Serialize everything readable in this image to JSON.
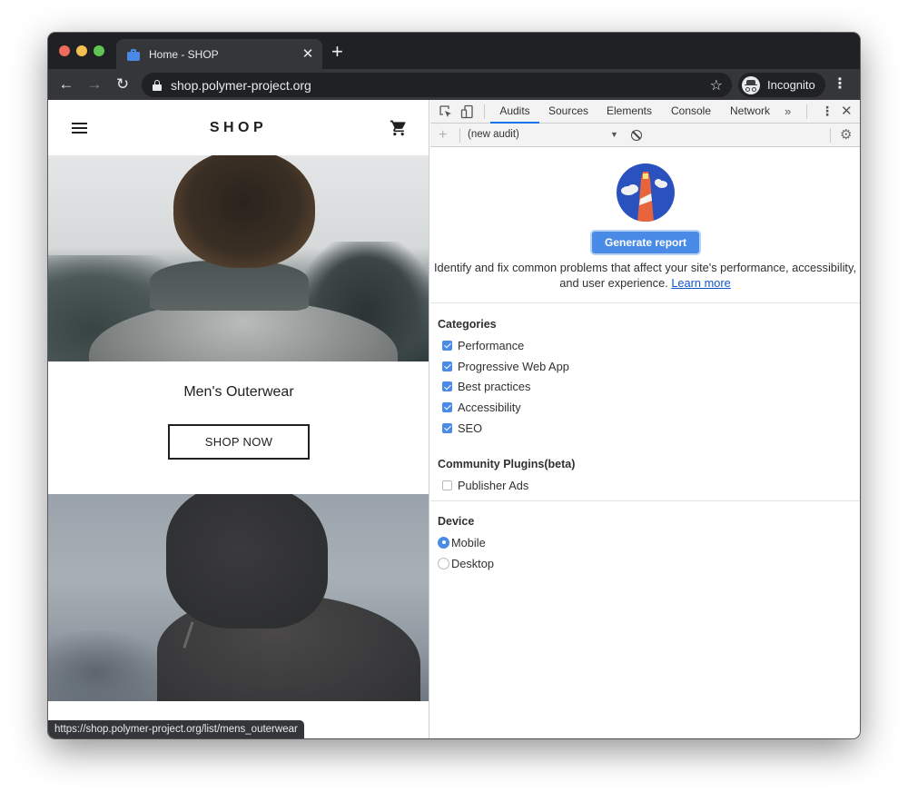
{
  "browser": {
    "tab": {
      "title": "Home - SHOP",
      "favicon": "shopping-bag-icon",
      "close_glyph": "✕"
    },
    "new_tab_glyph": "+",
    "nav": {
      "back_glyph": "←",
      "forward_glyph": "→",
      "reload_glyph": "↻"
    },
    "address_bar": {
      "url": "shop.polymer-project.org",
      "secure_icon": "lock-icon",
      "bookmark_glyph": "☆"
    },
    "profile": {
      "label": "Incognito",
      "icon": "incognito-icon"
    },
    "menu_glyph": "⋮",
    "status_url": "https://shop.polymer-project.org/list/mens_outerwear"
  },
  "page": {
    "header": {
      "title": "SHOP",
      "menu_icon": "hamburger-icon",
      "cart_icon": "cart-icon"
    },
    "promo": {
      "title": "Men's Outerwear",
      "button_label": "SHOP NOW"
    },
    "images": [
      {
        "alt": "man-in-grey-sweater-hero"
      },
      {
        "alt": "person-in-hooded-sweater-hero"
      }
    ]
  },
  "devtools": {
    "tabs": [
      {
        "label": "Audits",
        "active": true
      },
      {
        "label": "Sources",
        "active": false
      },
      {
        "label": "Elements",
        "active": false
      },
      {
        "label": "Console",
        "active": false
      },
      {
        "label": "Network",
        "active": false
      }
    ],
    "overflow_glyph": "»",
    "kebab_glyph": "⋮",
    "close_glyph": "✕",
    "toolbar": {
      "add_glyph": "+",
      "audit_select": "(new audit)",
      "caret_glyph": "▼",
      "settings_glyph": "⚙"
    },
    "audits": {
      "generate_label": "Generate report",
      "description": "Identify and fix common problems that affect your site's performance, accessibility, and user experience.",
      "learn_more": "Learn more",
      "categories": {
        "title": "Categories",
        "items": [
          {
            "label": "Performance",
            "checked": true
          },
          {
            "label": "Progressive Web App",
            "checked": true
          },
          {
            "label": "Best practices",
            "checked": true
          },
          {
            "label": "Accessibility",
            "checked": true
          },
          {
            "label": "SEO",
            "checked": true
          }
        ]
      },
      "plugins": {
        "title": "Community Plugins(beta)",
        "items": [
          {
            "label": "Publisher Ads",
            "checked": false
          }
        ]
      },
      "device": {
        "title": "Device",
        "options": [
          {
            "label": "Mobile",
            "selected": true
          },
          {
            "label": "Desktop",
            "selected": false
          }
        ]
      }
    },
    "colors": {
      "accent": "#4b8be8",
      "link": "#1155cc",
      "active_tab_underline": "#1a73e8"
    }
  }
}
